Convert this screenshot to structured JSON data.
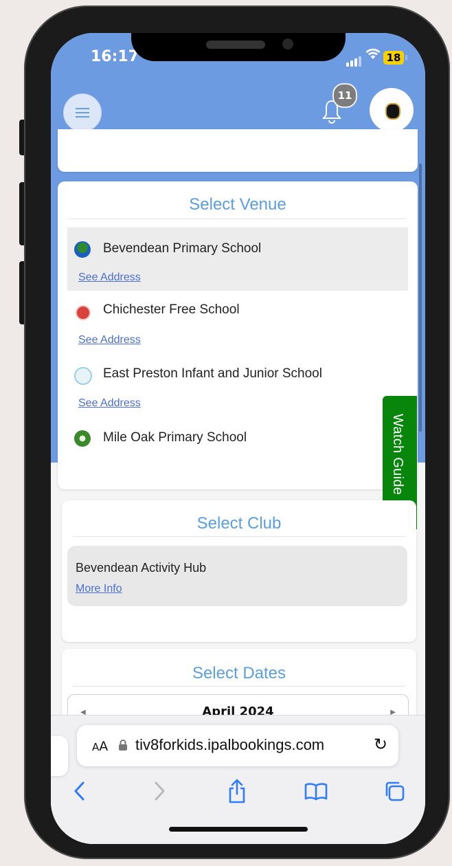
{
  "status_bar": {
    "time": "16:17",
    "battery": "18"
  },
  "header": {
    "notification_count": "11"
  },
  "venues": {
    "title": "Select Venue",
    "items": [
      {
        "name": "Bevendean Primary School",
        "link": "See Address",
        "selected": true
      },
      {
        "name": "Chichester Free School",
        "link": "See Address",
        "selected": false
      },
      {
        "name": "East Preston Infant and Junior School",
        "link": "See Address",
        "selected": false
      },
      {
        "name": "Mile Oak Primary School",
        "selected": false
      }
    ]
  },
  "watch_guide": {
    "label": "Watch Guide"
  },
  "clubs": {
    "title": "Select Club",
    "items": [
      {
        "name": "Bevendean Activity Hub",
        "link": "More Info"
      }
    ]
  },
  "dates": {
    "title": "Select Dates",
    "month": "April 2024"
  },
  "browser": {
    "text_size_label_small": "A",
    "text_size_label_large": "A",
    "url": "tiv8forkids.ipalbookings.com"
  },
  "colors": {
    "header": "#6d9be2",
    "accent": "#5b9ee0",
    "watch_guide": "#08850b",
    "link": "#4a6fd0"
  }
}
